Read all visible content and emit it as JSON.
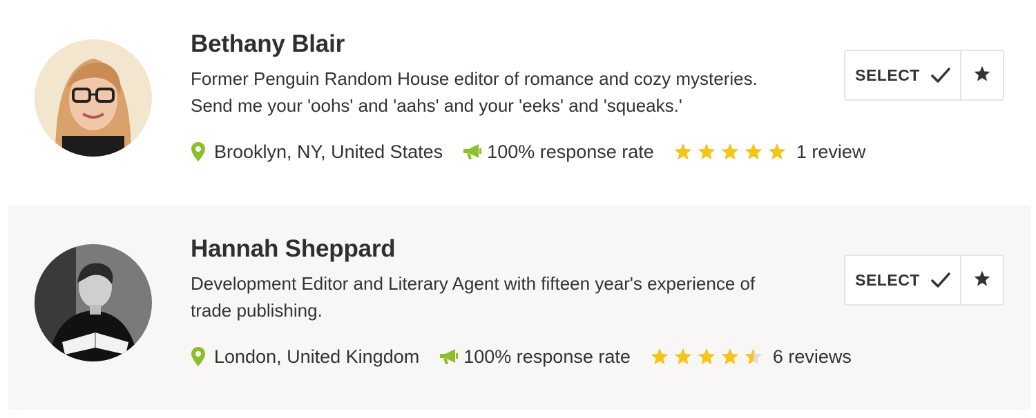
{
  "colors": {
    "accent_green": "#8cc02a",
    "star_gold": "#f5c518",
    "star_empty": "#dddddd",
    "alt_row_bg": "#f8f7f5"
  },
  "profiles": [
    {
      "name": "Bethany Blair",
      "bio_lines": [
        "Former Penguin Random House editor of romance and cozy mysteries.",
        "Send me your 'oohs' and 'aahs' and your 'eeks' and 'squeaks.'"
      ],
      "location": "Brooklyn, NY, United States",
      "response_rate": "100% response rate",
      "rating": 5,
      "reviews": "1 review",
      "select_label": "SELECT",
      "icons": {
        "location": "map-pin-icon",
        "response": "megaphone-icon",
        "select": "checkmark-icon",
        "favorite": "star-icon"
      }
    },
    {
      "name": "Hannah Sheppard",
      "bio_lines": [
        "Development Editor and Literary Agent with fifteen year's experience of",
        "trade publishing."
      ],
      "location": "London, United Kingdom",
      "response_rate": "100% response rate",
      "rating": 4.5,
      "reviews": "6 reviews",
      "select_label": "SELECT",
      "icons": {
        "location": "map-pin-icon",
        "response": "megaphone-icon",
        "select": "checkmark-icon",
        "favorite": "star-icon"
      }
    }
  ]
}
